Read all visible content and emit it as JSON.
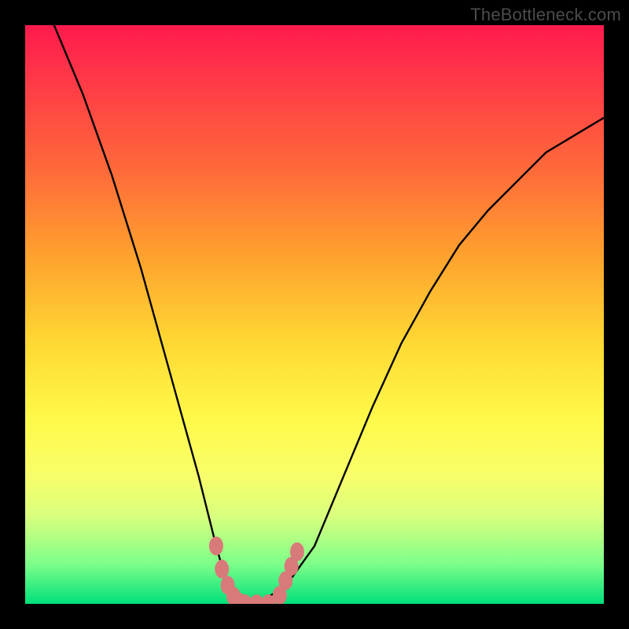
{
  "watermark": {
    "text": "TheBottleneck.com"
  },
  "chart_data": {
    "type": "line",
    "title": "",
    "xlabel": "",
    "ylabel": "",
    "xlim": [
      0,
      100
    ],
    "ylim": [
      0,
      100
    ],
    "series": [
      {
        "name": "bottleneck-curve",
        "x": [
          5,
          10,
          15,
          20,
          25,
          30,
          33,
          35,
          37,
          40,
          45,
          50,
          55,
          60,
          65,
          70,
          75,
          80,
          85,
          90,
          95,
          100
        ],
        "values": [
          100,
          88,
          74,
          58,
          40,
          22,
          10,
          3,
          0,
          0,
          3,
          10,
          22,
          34,
          45,
          54,
          62,
          68,
          73,
          78,
          81,
          84
        ]
      }
    ],
    "markers": [
      {
        "name": "left-blob-1",
        "x": 33,
        "y": 10
      },
      {
        "name": "left-blob-2",
        "x": 34,
        "y": 6
      },
      {
        "name": "left-blob-3",
        "x": 35,
        "y": 3.2
      },
      {
        "name": "left-blob-4",
        "x": 36,
        "y": 1.3
      },
      {
        "name": "center-1",
        "x": 37,
        "y": 0.3
      },
      {
        "name": "center-2",
        "x": 38,
        "y": 0
      },
      {
        "name": "center-3",
        "x": 40,
        "y": 0
      },
      {
        "name": "center-4",
        "x": 42,
        "y": 0
      },
      {
        "name": "right-blob-1",
        "x": 44,
        "y": 1.5
      },
      {
        "name": "right-blob-2",
        "x": 45,
        "y": 4
      },
      {
        "name": "right-blob-3",
        "x": 46,
        "y": 6.5
      },
      {
        "name": "right-blob-4",
        "x": 47,
        "y": 9
      }
    ],
    "marker_color": "#d97a7a",
    "curve_color": "#000000"
  }
}
